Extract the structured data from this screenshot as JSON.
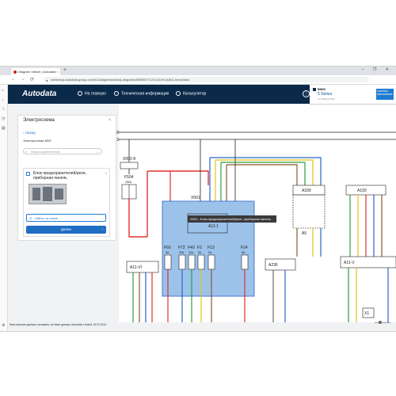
{
  "browser": {
    "tab_title": "Diagram Viewer | Autodata",
    "tab_close": "×",
    "new_tab": "+",
    "window_controls": "– ❐ ✕",
    "url": "workshop.autodata-group.com/w1/diagrams/wiring-diagrams/BMW07712/1141KH-A802-Ams/0/abs",
    "back": "←",
    "forward": "→",
    "reload": "⟳"
  },
  "app": {
    "logo": "Autodata",
    "nav": [
      {
        "label": "На главную"
      },
      {
        "label": "Техническая информация"
      },
      {
        "label": "Калькулятор"
      }
    ],
    "menu_icon": "⋮",
    "vehicle": {
      "brand": "BMW",
      "model": "5 Series",
      "details": "2.0 (530e) (F90)",
      "change_label": "Сменить автомобиль"
    }
  },
  "panel": {
    "title": "Электросхема",
    "pin_icon": "✎",
    "back_label": "‹ Назад",
    "system_name": "Электросхема ABS",
    "search_placeholder": "Поиск компонентов",
    "search_icon": "⌕",
    "chevron": "⌄",
    "component": {
      "title": "Блок предохранителей/реле, приборная панель",
      "close": "×",
      "find_label": "Найти на схеме",
      "next_label": "Далее",
      "chevron": "›"
    }
  },
  "status_text": "Фактические данные основаны на базе данных Autodata Limited 1972-2019",
  "tooltip": "X001 - Блок предохранителей/реле, приборная панель",
  "diagram": {
    "bus_labels": [
      "30",
      "15"
    ],
    "connector_x002": "X002-8",
    "fuse_f504": {
      "name": "F504",
      "rating": "250A"
    },
    "fusebox_label": "X001",
    "relay_label": "A11-1",
    "fuses": [
      {
        "name": "F60",
        "rating": "5A"
      },
      {
        "name": "F72",
        "rating": "30A"
      },
      {
        "name": "F40",
        "rating": "20A"
      },
      {
        "name": "F2",
        "rating": "5A"
      },
      {
        "name": "F13",
        "rating": "5A"
      },
      {
        "name": "F24",
        "rating": "5A"
      }
    ],
    "modules": [
      "A11-VI",
      "A236",
      "A339",
      "A5",
      "A193",
      "A11-V",
      "X1"
    ],
    "wire_colors": {
      "red": "#e0312f",
      "blue": "#2a63c9",
      "yellow": "#e2c316",
      "green": "#2f9e44",
      "brown": "#8a5a2b",
      "black": "#222222",
      "highlight": "#4a90d9"
    }
  }
}
